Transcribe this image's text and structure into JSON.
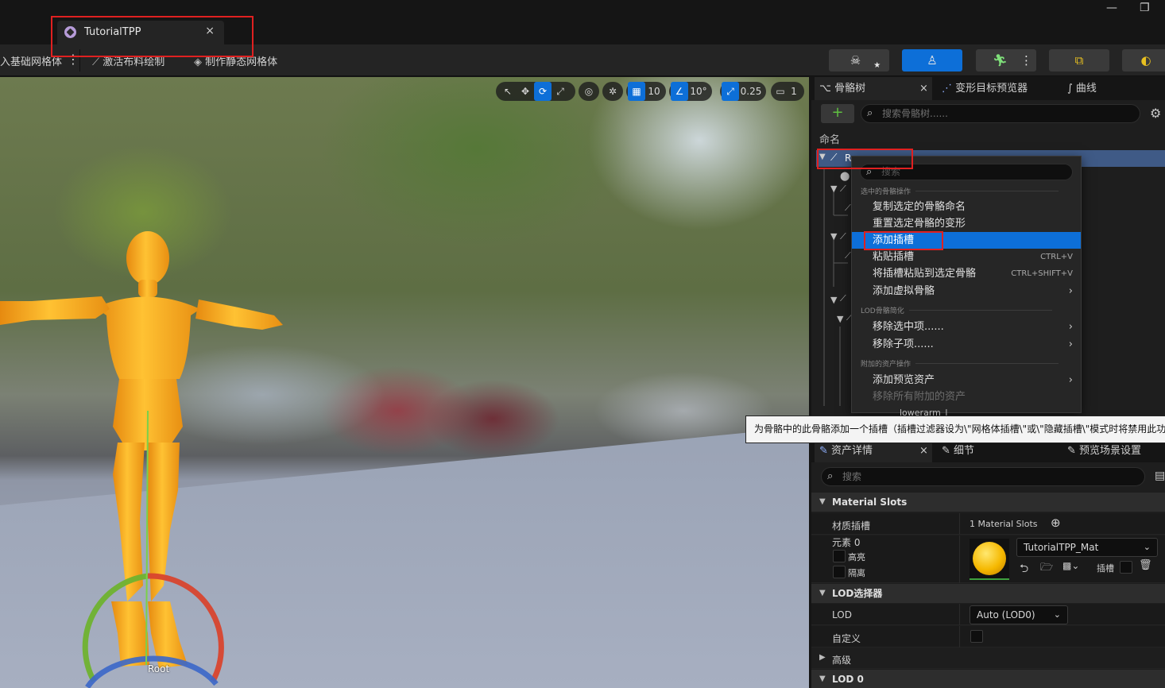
{
  "titlebar": {
    "tab_title": "TutorialTPP",
    "tab_close": "×",
    "minimize": "—",
    "maximize": "❐"
  },
  "toolbar": {
    "item_base_mesh": "入基础网格体",
    "more": "⋮",
    "item_cloth": "激活布料绘制",
    "item_static_mesh": "制作静态网格体",
    "mode_icons": [
      "skeleton-icon",
      "skeletal-mesh-icon",
      "animation-icon",
      "blueprint-icon",
      "physics-icon"
    ]
  },
  "viewport": {
    "tools": {
      "grid_snap": "10",
      "angle_snap": "10°",
      "scale_snap": "0.25",
      "camera_speed": "1"
    },
    "root_label": "Root"
  },
  "skeleton_panel": {
    "tabs": [
      {
        "label": "骨骼树",
        "icon": "skeleton-tree-icon"
      },
      {
        "label": "变形目标预览器",
        "icon": "morph-target-icon"
      },
      {
        "label": "曲线",
        "icon": "curve-icon"
      }
    ],
    "tab_close": "×",
    "add_button": "+",
    "search_placeholder": "搜索骨骼树......",
    "column_header": "命名",
    "selected_row": "R"
  },
  "context_menu": {
    "search_placeholder": "搜索",
    "section1": "选中的骨骼操作",
    "items1": [
      {
        "label": "复制选定的骨骼命名",
        "shortcut": ""
      },
      {
        "label": "重置选定骨骼的变形",
        "shortcut": ""
      },
      {
        "label": "添加插槽",
        "shortcut": ""
      },
      {
        "label": "粘贴插槽",
        "shortcut": "CTRL+V"
      },
      {
        "label": "将插槽粘贴到选定骨骼",
        "shortcut": "CTRL+SHIFT+V"
      },
      {
        "label": "添加虚拟骨骼",
        "shortcut": "›"
      }
    ],
    "section2": "LOD骨骼简化",
    "items2": [
      {
        "label": "移除选中项......",
        "shortcut": "›"
      },
      {
        "label": "移除子项......",
        "shortcut": "›"
      }
    ],
    "section3": "附加的资产操作",
    "items3": [
      {
        "label": "添加预览资产",
        "shortcut": "›"
      },
      {
        "label": "移除所有附加的资产",
        "shortcut": ""
      }
    ],
    "hidden_row_text": "lowerarm_l"
  },
  "tooltip": "为骨骼中的此骨骼添加一个插槽（插槽过滤器设为\\\"网格体插槽\\\"或\\\"隐藏插槽\\\"模式时将禁用此功",
  "details_panel": {
    "tabs": [
      {
        "label": "资产详情",
        "icon": "asset-details-icon"
      },
      {
        "label": "细节",
        "icon": "details-icon"
      },
      {
        "label": "预览场景设置",
        "icon": "preview-settings-icon"
      }
    ],
    "tab_close": "×",
    "search_placeholder": "搜索",
    "material_slots": {
      "category": "Material Slots",
      "row_label": "材质插槽",
      "count": "1 Material Slots",
      "element_label": "元素 0",
      "highlight_label": "高亮",
      "isolate_label": "隔离",
      "material_name": "TutorialTPP_Mat",
      "slot_label": "插槽"
    },
    "lod_picker": {
      "category": "LOD选择器",
      "lod_label": "LOD",
      "lod_value": "Auto (LOD0)",
      "custom_label": "自定义"
    },
    "advanced": "高级",
    "lod0": "LOD 0"
  },
  "colors": {
    "accent": "#0d6fd8",
    "highlight_box": "#e02020",
    "mannequin": "#f5a623",
    "add_green": "#5fc040"
  }
}
